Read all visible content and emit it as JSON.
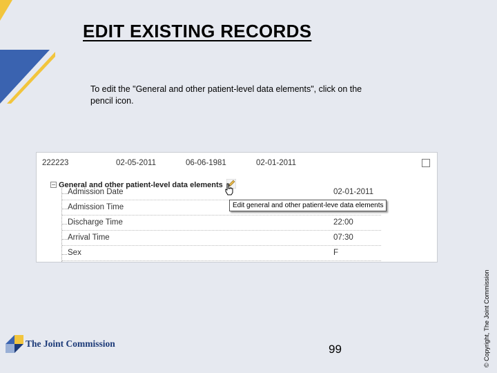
{
  "slide": {
    "title": "EDIT EXISTING RECORDS",
    "instructions": "To edit the \"General and other patient-level data elements\", click on the pencil icon.",
    "page_number": "99",
    "copyright": "© Copyright, The Joint Commission"
  },
  "logo": {
    "text": "The Joint Commission"
  },
  "screenshot": {
    "record": {
      "id": "222223",
      "date1": "02-05-2011",
      "date2": "06-06-1981",
      "date3": "02-01-2011"
    },
    "group_title": "General and other patient-level data elements",
    "tooltip": "Edit general and other patient-leve data elements",
    "fields": [
      {
        "label": "Admission Date",
        "value": "02-01-2011"
      },
      {
        "label": "Admission Time",
        "value": ""
      },
      {
        "label": "Discharge Time",
        "value": "22:00"
      },
      {
        "label": "Arrival Time",
        "value": "07:30"
      },
      {
        "label": "Sex",
        "value": "F"
      }
    ]
  },
  "colors": {
    "accent_blue": "#3a63b0",
    "accent_yellow": "#f2c53d",
    "logo_navy": "#1c3a78"
  },
  "icons": [
    "pencil-icon",
    "hand-cursor-icon",
    "collapse-minus-icon",
    "checkbox-icon",
    "joint-commission-logo-icon"
  ]
}
